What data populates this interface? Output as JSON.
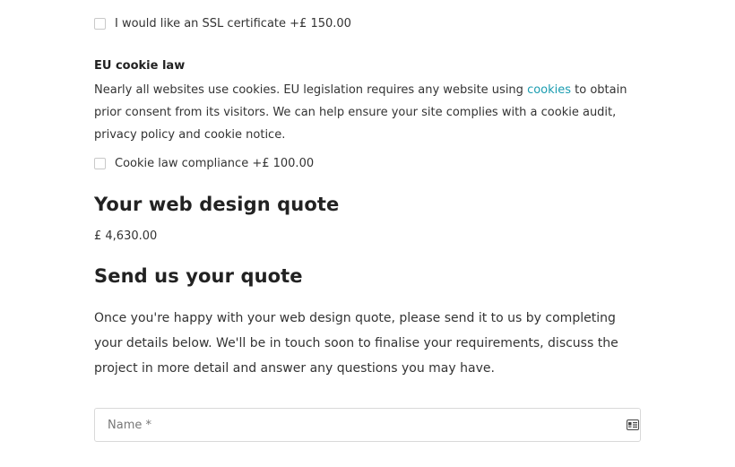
{
  "ssl": {
    "label": "I would like an SSL certificate +£ 150.00",
    "checked": false
  },
  "cookie_law": {
    "heading": "EU cookie law",
    "desc_before": "Nearly all websites use cookies. EU legislation requires any website using ",
    "link_text": "cookies",
    "desc_after": " to obtain prior consent from its visitors. We can help ensure your site complies with a cookie audit, privacy policy and cookie notice.",
    "checkbox_label": "Cookie law compliance +£ 100.00",
    "checked": false
  },
  "quote": {
    "heading": "Your web design quote",
    "total": "£ 4,630.00"
  },
  "send": {
    "heading": "Send us your quote",
    "desc": "Once you're happy with your web design quote, please send it to us by completing your details below. We'll be in touch soon to finalise your requirements, discuss the project in more detail and answer any questions you may have."
  },
  "form": {
    "name_placeholder": "Name *",
    "name_value": ""
  },
  "colors": {
    "link": "#1a9cb0",
    "heading": "#222222",
    "text": "#333333"
  },
  "icons": {
    "name_field_icon": "contact-card-icon"
  }
}
